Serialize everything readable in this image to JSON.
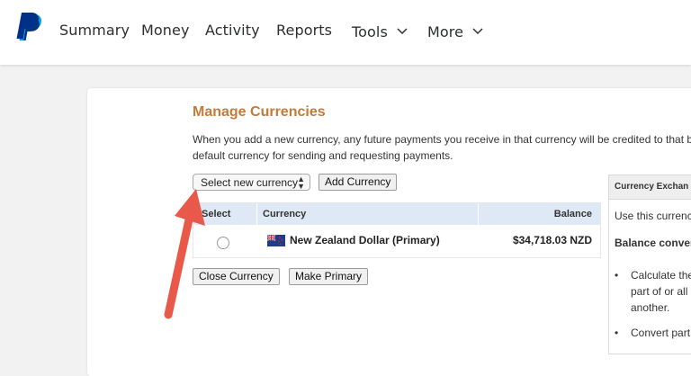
{
  "nav": {
    "items": [
      {
        "label": "Summary"
      },
      {
        "label": "Money"
      },
      {
        "label": "Activity"
      },
      {
        "label": "Reports"
      },
      {
        "label": "Tools",
        "has_dropdown": true
      },
      {
        "label": "More",
        "has_dropdown": true
      }
    ],
    "logo_icon": "paypal-logo-icon",
    "brand_colors": {
      "dark": "#003087",
      "light": "#009cde"
    }
  },
  "page": {
    "title": "Manage Currencies",
    "description_line1": "When you add a new currency, any future payments you receive in that currency will be credited to that b",
    "description_line2": "default currency for sending and requesting payments.",
    "title_color": "#c47a39"
  },
  "controls": {
    "select_value": "Select new currency",
    "add_currency_label": "Add Currency"
  },
  "table": {
    "headers": {
      "select": "Select",
      "currency": "Currency",
      "balance": "Balance"
    },
    "rows": [
      {
        "currency": "New Zealand Dollar (Primary)",
        "balance": "$34,718.03 NZD",
        "flag_icon": "nz-flag-icon",
        "selected": false
      }
    ],
    "header_bg": "#dfe9f5"
  },
  "actions": {
    "close_currency_label": "Close Currency",
    "make_primary_label": "Make Primary"
  },
  "exchange_panel": {
    "title": "Currency Exchan",
    "line1": "Use this currenc",
    "line2": "Balance conver",
    "bullet1_lines": [
      "Calculate the",
      "part of or all y",
      "another."
    ],
    "bullet2_lines": [
      "Convert part"
    ]
  },
  "annotation": {
    "arrow_color": "#e8594a"
  }
}
